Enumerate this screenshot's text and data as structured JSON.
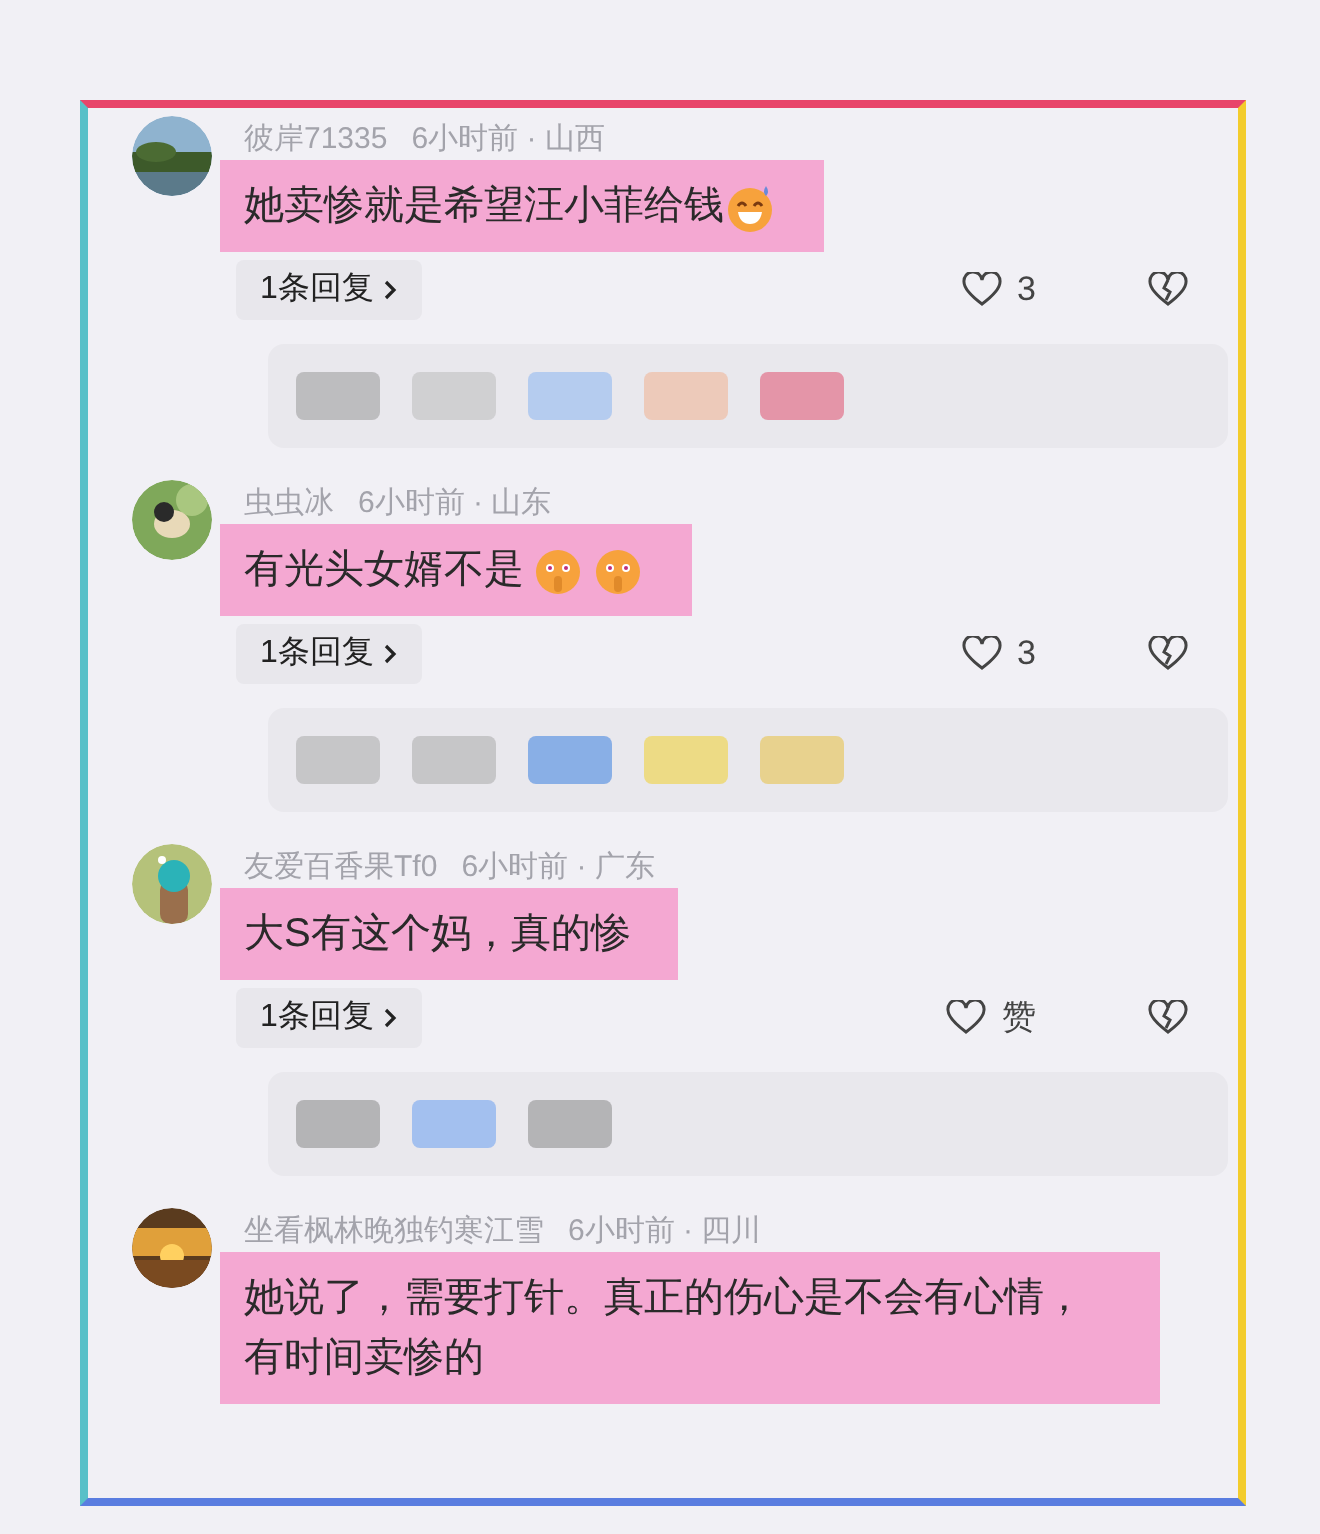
{
  "comments": [
    {
      "username": "彼岸71335",
      "meta": "6小时前 · 山西",
      "text": "她卖惨就是希望汪小菲给钱",
      "emojis": [
        {
          "kind": "grin-sweat"
        }
      ],
      "reply_button": "1条回复",
      "likes": "3"
    },
    {
      "username": "虫虫冰",
      "meta": "6小时前 · 山东",
      "text": "有光头女婿不是",
      "emojis": [
        {
          "kind": "shush"
        },
        {
          "kind": "shush"
        }
      ],
      "reply_button": "1条回复",
      "likes": "3"
    },
    {
      "username": "友爱百香果Tf0",
      "meta": "6小时前 · 广东",
      "text": "大S有这个妈，真的惨",
      "reply_button": "1条回复",
      "likes": "赞"
    },
    {
      "username": "坐看枫林晚独钓寒江雪",
      "meta": "6小时前 · 四川",
      "text": "她说了，需要打针。真正的伤心是不会有心情，有时间卖惨的"
    }
  ]
}
